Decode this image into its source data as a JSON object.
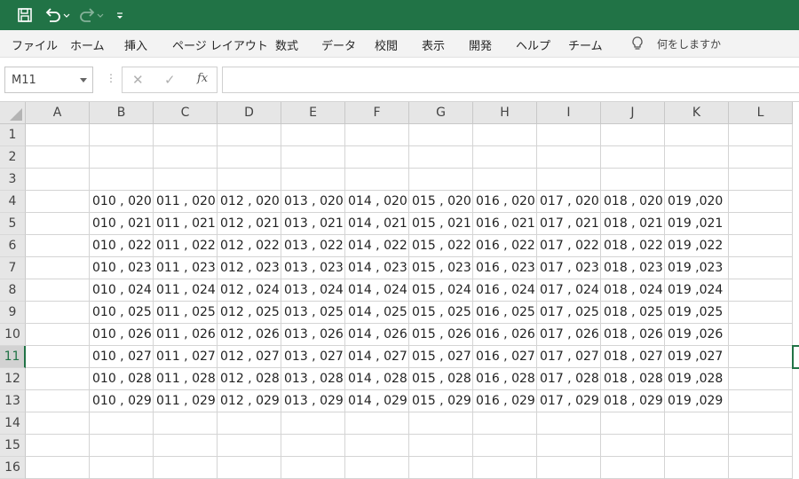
{
  "quick_access": {
    "icons": [
      "save-icon",
      "undo-icon",
      "redo-icon",
      "customize-icon"
    ]
  },
  "ribbon": {
    "tabs": [
      "ファイル",
      "ホーム",
      "挿入",
      "ページ レイアウト",
      "数式",
      "データ",
      "校閲",
      "表示",
      "開発",
      "ヘルプ",
      "チーム"
    ],
    "tell_me": "何をしますか"
  },
  "formula_bar": {
    "name_box": "M11",
    "cancel": "✕",
    "enter": "✓",
    "fx": "fx",
    "formula": ""
  },
  "sheet": {
    "columns": [
      "A",
      "B",
      "C",
      "D",
      "E",
      "F",
      "G",
      "H",
      "I",
      "J",
      "K",
      "L"
    ],
    "rows": [
      "1",
      "2",
      "3",
      "4",
      "5",
      "6",
      "7",
      "8",
      "9",
      "10",
      "11",
      "12",
      "13",
      "14",
      "15",
      "16"
    ],
    "active_row": "11",
    "data_start_row": 4,
    "data_start_col": "B",
    "values": [
      [
        "010 , 020",
        "011 , 020",
        "012 , 020",
        "013 , 020",
        "014 , 020",
        "015 , 020",
        "016 , 020",
        "017 , 020",
        "018 , 020",
        "019 ,020"
      ],
      [
        "010 , 021",
        "011 , 021",
        "012 , 021",
        "013 , 021",
        "014 , 021",
        "015 , 021",
        "016 , 021",
        "017 , 021",
        "018 , 021",
        "019 ,021"
      ],
      [
        "010 , 022",
        "011 , 022",
        "012 , 022",
        "013 , 022",
        "014 , 022",
        "015 , 022",
        "016 , 022",
        "017 , 022",
        "018 , 022",
        "019 ,022"
      ],
      [
        "010 , 023",
        "011 , 023",
        "012 , 023",
        "013 , 023",
        "014 , 023",
        "015 , 023",
        "016 , 023",
        "017 , 023",
        "018 , 023",
        "019 ,023"
      ],
      [
        "010 , 024",
        "011 , 024",
        "012 , 024",
        "013 , 024",
        "014 , 024",
        "015 , 024",
        "016 , 024",
        "017 , 024",
        "018 , 024",
        "019 ,024"
      ],
      [
        "010 , 025",
        "011 , 025",
        "012 , 025",
        "013 , 025",
        "014 , 025",
        "015 , 025",
        "016 , 025",
        "017 , 025",
        "018 , 025",
        "019 ,025"
      ],
      [
        "010 , 026",
        "011 , 026",
        "012 , 026",
        "013 , 026",
        "014 , 026",
        "015 , 026",
        "016 , 026",
        "017 , 026",
        "018 , 026",
        "019 ,026"
      ],
      [
        "010 , 027",
        "011 , 027",
        "012 , 027",
        "013 , 027",
        "014 , 027",
        "015 , 027",
        "016 , 027",
        "017 , 027",
        "018 , 027",
        "019 ,027"
      ],
      [
        "010 , 028",
        "011 , 028",
        "012 , 028",
        "013 , 028",
        "014 , 028",
        "015 , 028",
        "016 , 028",
        "017 , 028",
        "018 , 028",
        "019 ,028"
      ],
      [
        "010 , 029",
        "011 , 029",
        "012 , 029",
        "013 , 029",
        "014 , 029",
        "015 , 029",
        "016 , 029",
        "017 , 029",
        "018 , 029",
        "019 ,029"
      ]
    ]
  },
  "colors": {
    "accent": "#217346",
    "ribbon_bg": "#f3f3f3",
    "header_bg": "#e6e6e6",
    "gridline": "#d4d4d4"
  }
}
